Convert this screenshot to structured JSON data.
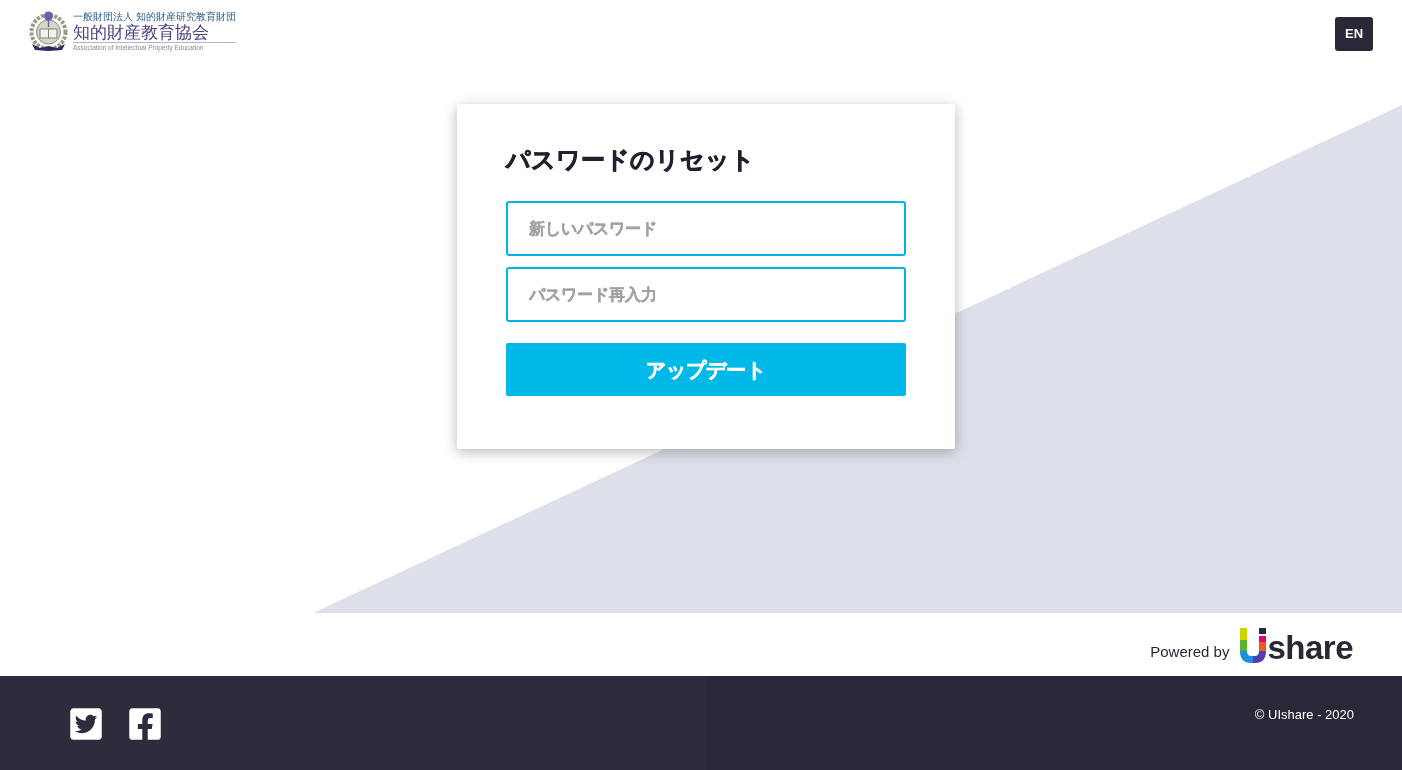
{
  "header": {
    "logo": {
      "subtitle": "一般財団法人 知的財産研究教育財団",
      "name": "知的財産教育協会",
      "english_name": "Association of Intellectual Property Education"
    },
    "language_button": "EN"
  },
  "reset_form": {
    "title": "パスワードのリセット",
    "fields": [
      {
        "placeholder": "新しいパスワード"
      },
      {
        "placeholder": "パスワード再入力"
      }
    ],
    "submit_button": "アップデート"
  },
  "powered_by": {
    "label": "Powered by",
    "brand": "share"
  },
  "footer": {
    "social_links": [
      {
        "kind": "twitter"
      },
      {
        "kind": "facebook"
      }
    ],
    "copyright": "© UIshare - 2020"
  }
}
